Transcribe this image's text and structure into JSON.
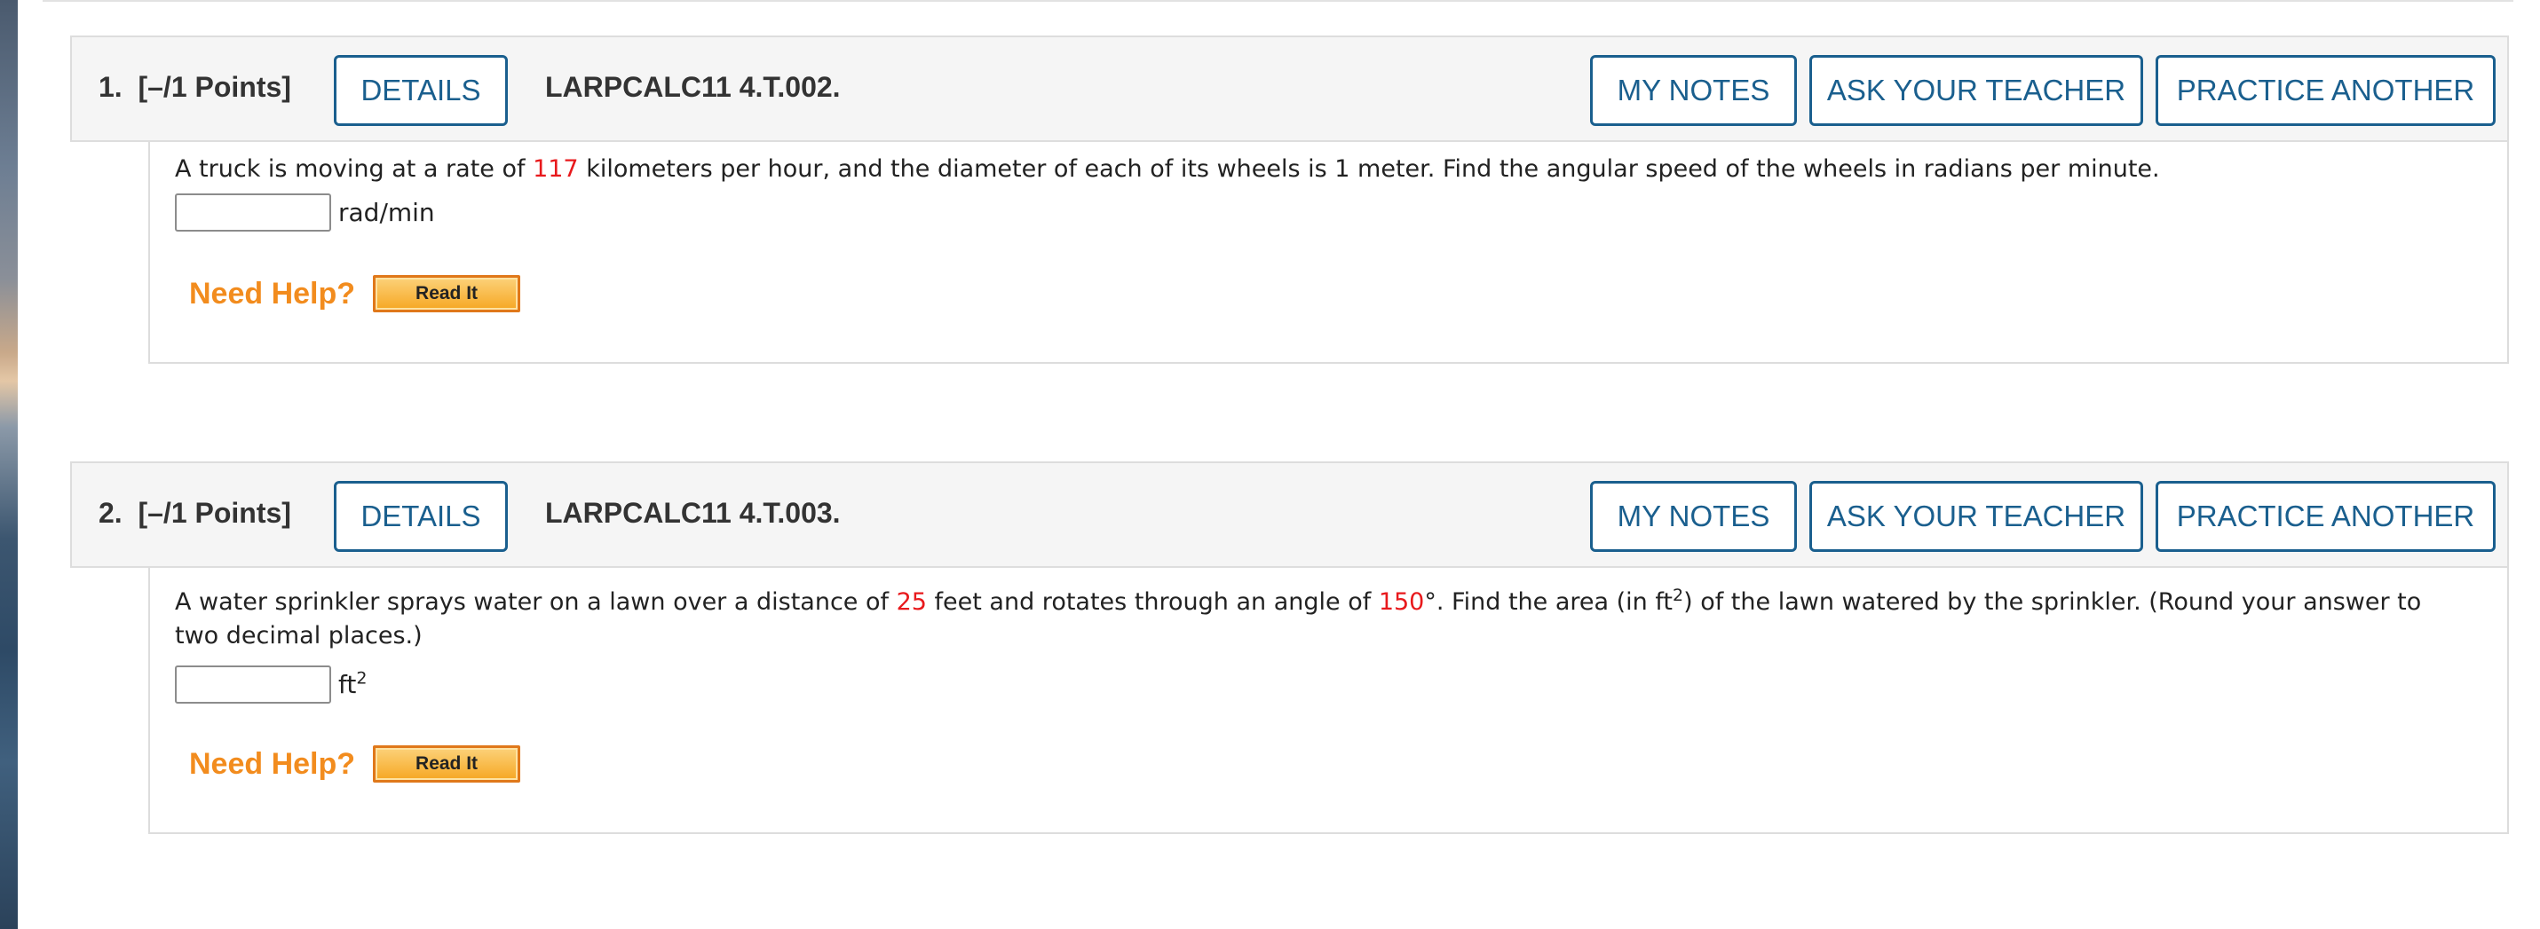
{
  "questions": [
    {
      "number": "1.",
      "points": "[–/1 Points]",
      "details_label": "DETAILS",
      "code": "LARPCALC11 4.T.002.",
      "my_notes_label": "MY NOTES",
      "ask_teacher_label": "ASK YOUR TEACHER",
      "practice_label": "PRACTICE ANOTHER",
      "text_parts": [
        "A truck is moving at a rate of ",
        "117",
        " kilometers per hour, and the diameter of each of its wheels is 1 meter. Find the angular speed of the wheels in radians per minute."
      ],
      "unit": "rad/min",
      "need_help": "Need Help?",
      "read_it": "Read It"
    },
    {
      "number": "2.",
      "points": "[–/1 Points]",
      "details_label": "DETAILS",
      "code": "LARPCALC11 4.T.003.",
      "my_notes_label": "MY NOTES",
      "ask_teacher_label": "ASK YOUR TEACHER",
      "practice_label": "PRACTICE ANOTHER",
      "text_parts": [
        "A water sprinkler sprays water on a lawn over a distance of ",
        "25",
        " feet and rotates through an angle of ",
        "150",
        "°. Find the area (in ft",
        "2",
        ") of the lawn watered by the sprinkler. (Round your answer to two decimal places.)"
      ],
      "unit": "ft",
      "unit_sup": "2",
      "need_help": "Need Help?",
      "read_it": "Read It"
    }
  ],
  "colors": {
    "accent": "#1a5f8e",
    "highlight_value": "#e8191c",
    "need_help": "#f28c1e"
  }
}
